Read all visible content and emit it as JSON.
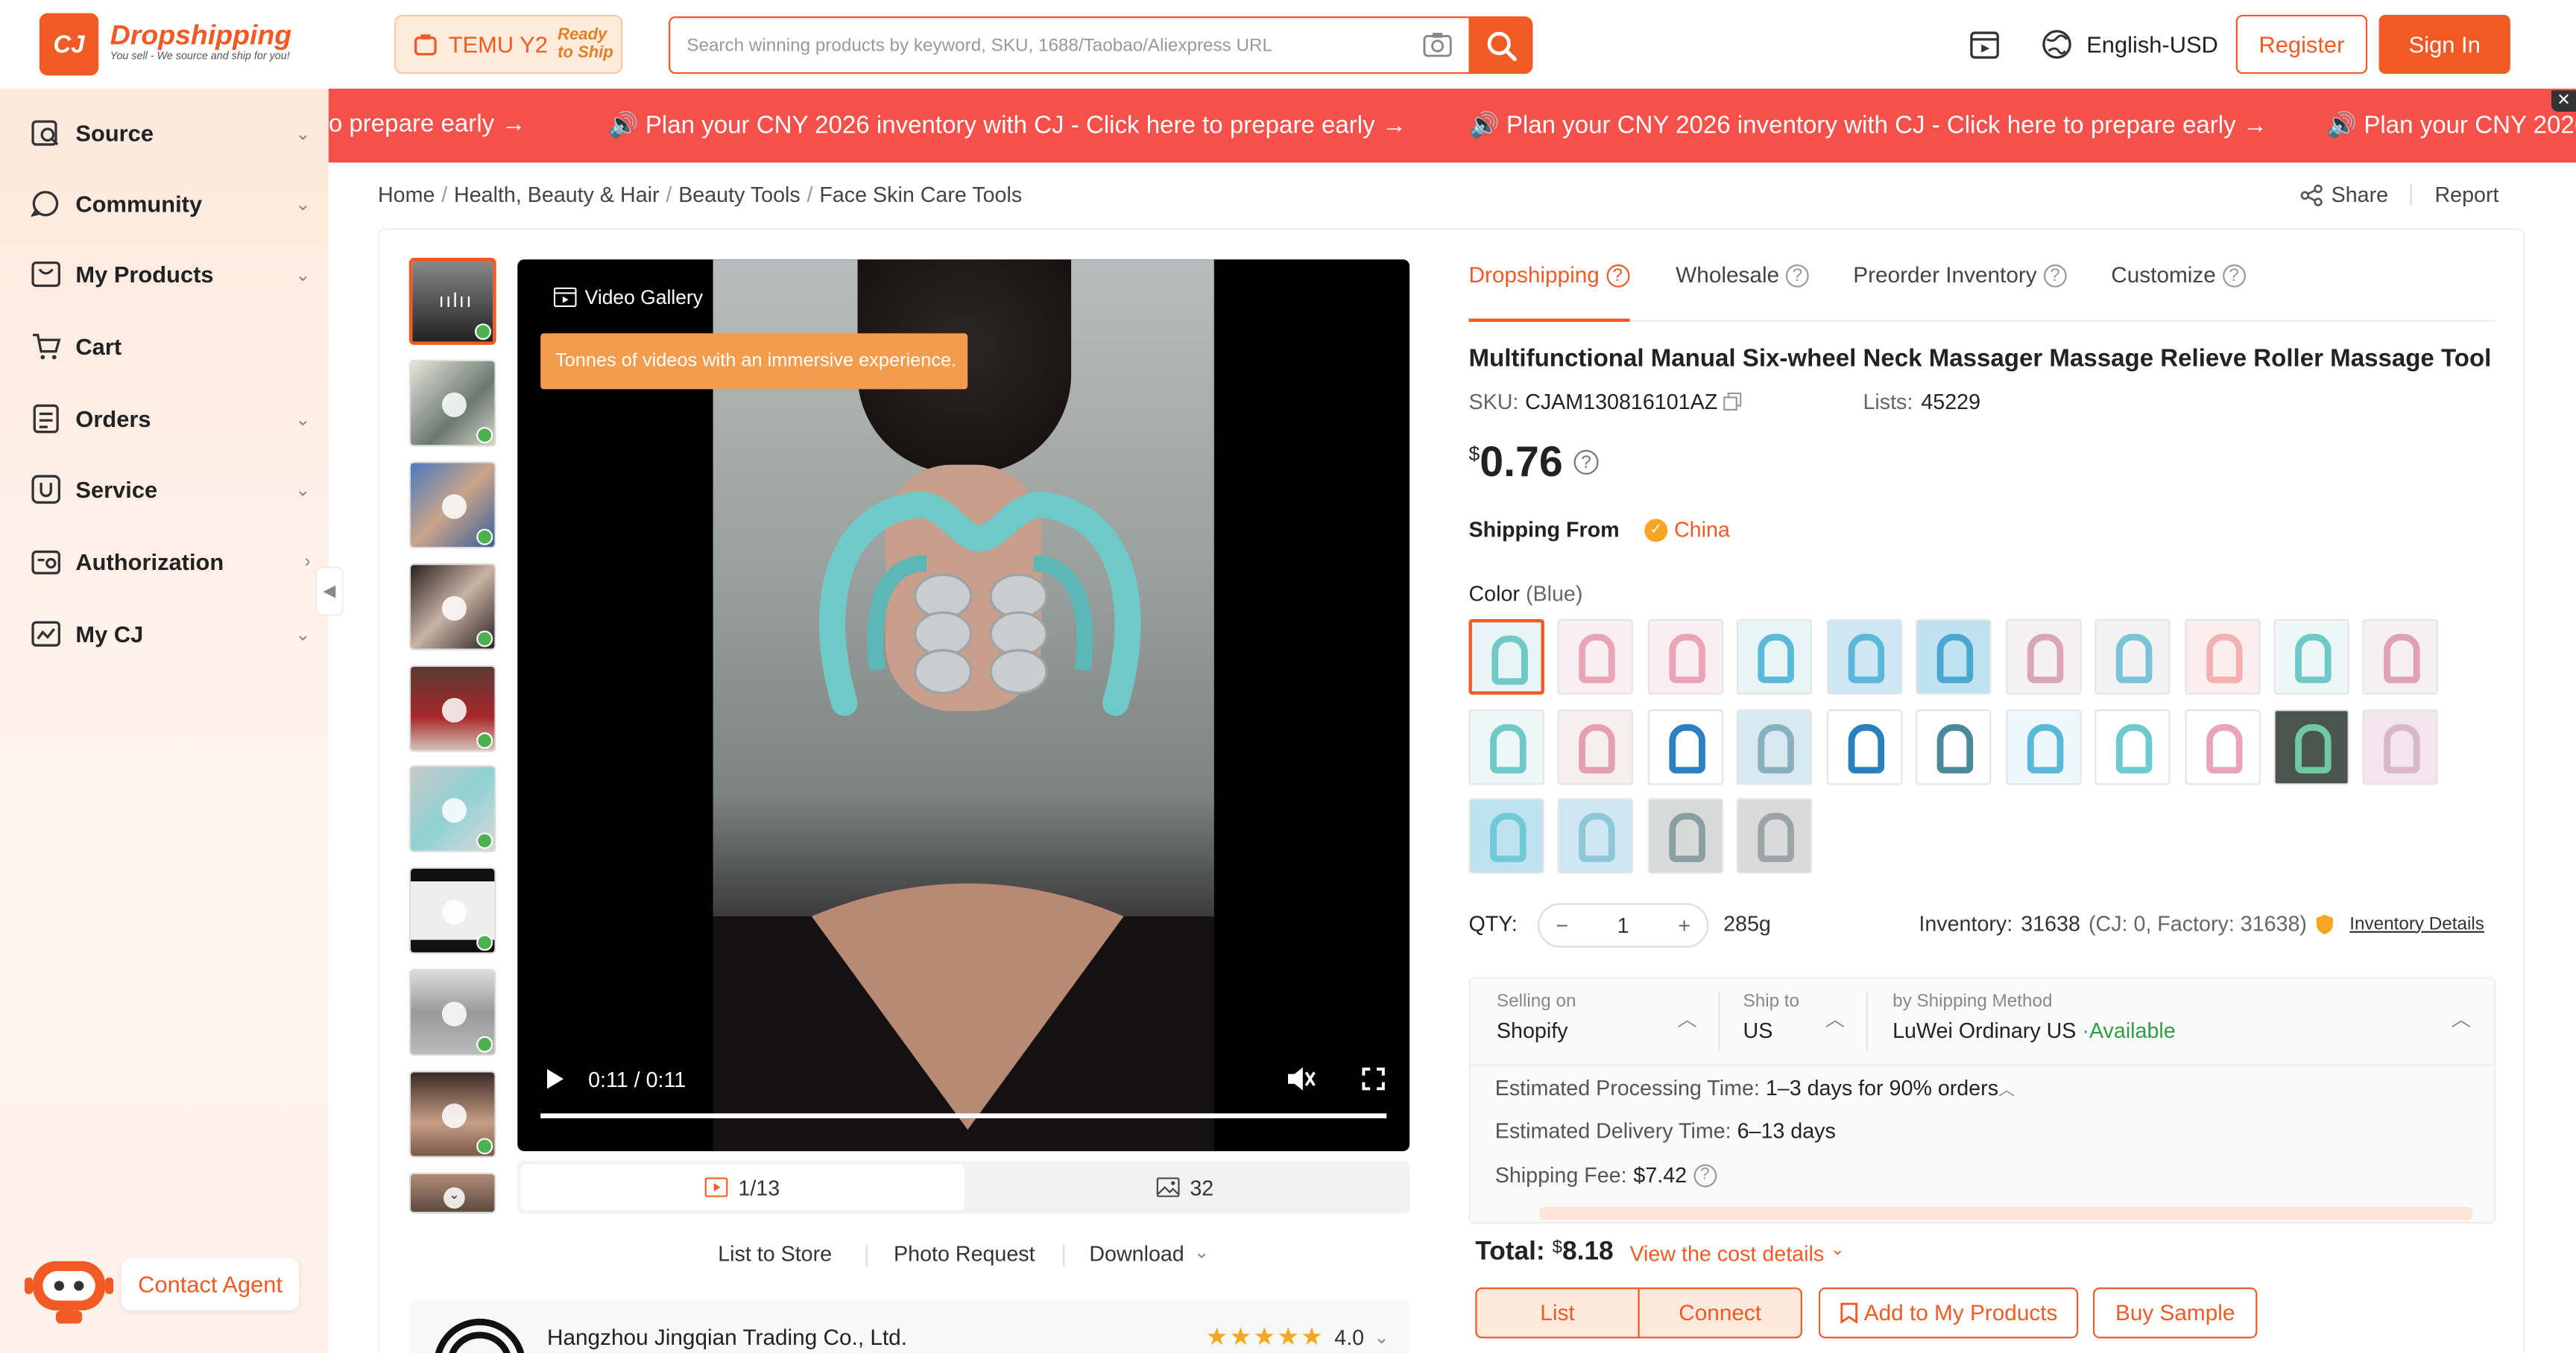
{
  "header": {
    "logo_mark": "CJ",
    "logo_name": "Dropshipping",
    "logo_tagline": "You sell - We source and ship for you!",
    "temu_label": "TEMU Y2",
    "temu_ready": "Ready",
    "temu_ship": "to Ship",
    "search_placeholder": "Search winning products by keyword, SKU, 1688/Taobao/Aliexpress URL",
    "language": "English-USD",
    "register": "Register",
    "sign_in": "Sign In"
  },
  "sidebar": {
    "items": [
      {
        "label": "Source",
        "icon": "source-icon",
        "chevron": "⌄"
      },
      {
        "label": "Community",
        "icon": "community-icon",
        "chevron": "⌄"
      },
      {
        "label": "My Products",
        "icon": "products-icon",
        "chevron": "⌄"
      },
      {
        "label": "Cart",
        "icon": "cart-icon",
        "chevron": ""
      },
      {
        "label": "Orders",
        "icon": "orders-icon",
        "chevron": "⌄"
      },
      {
        "label": "Service",
        "icon": "service-icon",
        "chevron": "⌄"
      },
      {
        "label": "Authorization",
        "icon": "authorization-icon",
        "chevron": "›"
      },
      {
        "label": "My CJ",
        "icon": "mycj-icon",
        "chevron": "⌄"
      }
    ],
    "contact_agent": "Contact Agent"
  },
  "banner": {
    "segments": [
      "o prepare early →",
      "🔊 Plan your CNY 2026 inventory with CJ - Click here to prepare early →",
      "🔊 Plan your CNY 2026 inventory with CJ - Click here to prepare early →",
      "🔊 Plan your CNY 2026"
    ]
  },
  "breadcrumb": [
    "Home",
    "Health, Beauty & Hair",
    "Beauty Tools",
    "Face Skin Care Tools"
  ],
  "share": "Share",
  "report": "Report",
  "gallery": {
    "video_gallery_label": "Video Gallery",
    "tooltip": "Tonnes of videos with an immersive experience.",
    "time": "0:11 / 0:11",
    "video_count": "1/13",
    "image_count": "32",
    "progress": 1.0
  },
  "actions_left": {
    "list_to_store": "List to Store",
    "photo_request": "Photo Request",
    "download": "Download"
  },
  "seller": {
    "name": "Hangzhou Jingqian Trading Co., Ltd.",
    "rating": "4.0",
    "stars": 4
  },
  "tabs": [
    "Dropshipping",
    "Wholesale",
    "Preorder Inventory",
    "Customize"
  ],
  "product": {
    "title": "Multifunctional Manual Six-wheel Neck Massager Massage Relieve Roller Massage Tool",
    "sku_label": "SKU:",
    "sku": "CJAM130816101AZ",
    "lists_label": "Lists:",
    "lists": "45229",
    "currency": "$",
    "price": "0.76",
    "shipping_from_label": "Shipping From",
    "shipping_from": "China",
    "color_label": "Color",
    "color_value": "(Blue)",
    "qty_label": "QTY:",
    "qty": "1",
    "weight": "285g",
    "inventory_label": "Inventory:",
    "inventory": "31638",
    "inventory_breakdown": "(CJ: 0, Factory: 31638)",
    "inventory_details": "Inventory Details"
  },
  "shipping": {
    "selling_on_label": "Selling on",
    "selling_on": "Shopify",
    "ship_to_label": "Ship to",
    "ship_to": "US",
    "method_label": "by Shipping Method",
    "method": "LuWei Ordinary US",
    "availability": "·Available",
    "processing_label": "Estimated Processing Time:",
    "processing": "1–3 days for 90% orders",
    "delivery_label": "Estimated Delivery Time:",
    "delivery": "6–13 days",
    "fee_label": "Shipping Fee:",
    "fee": "$7.42"
  },
  "total": {
    "label": "Total:",
    "currency": "$",
    "amount": "8.18",
    "cost_details": "View the cost details"
  },
  "buttons": {
    "list": "List",
    "connect": "Connect",
    "add_to_products": "Add to My Products",
    "buy_sample": "Buy Sample"
  },
  "colors": {
    "accent": "#f15a24",
    "banner": "#f5504a",
    "available": "#2e9e44"
  }
}
